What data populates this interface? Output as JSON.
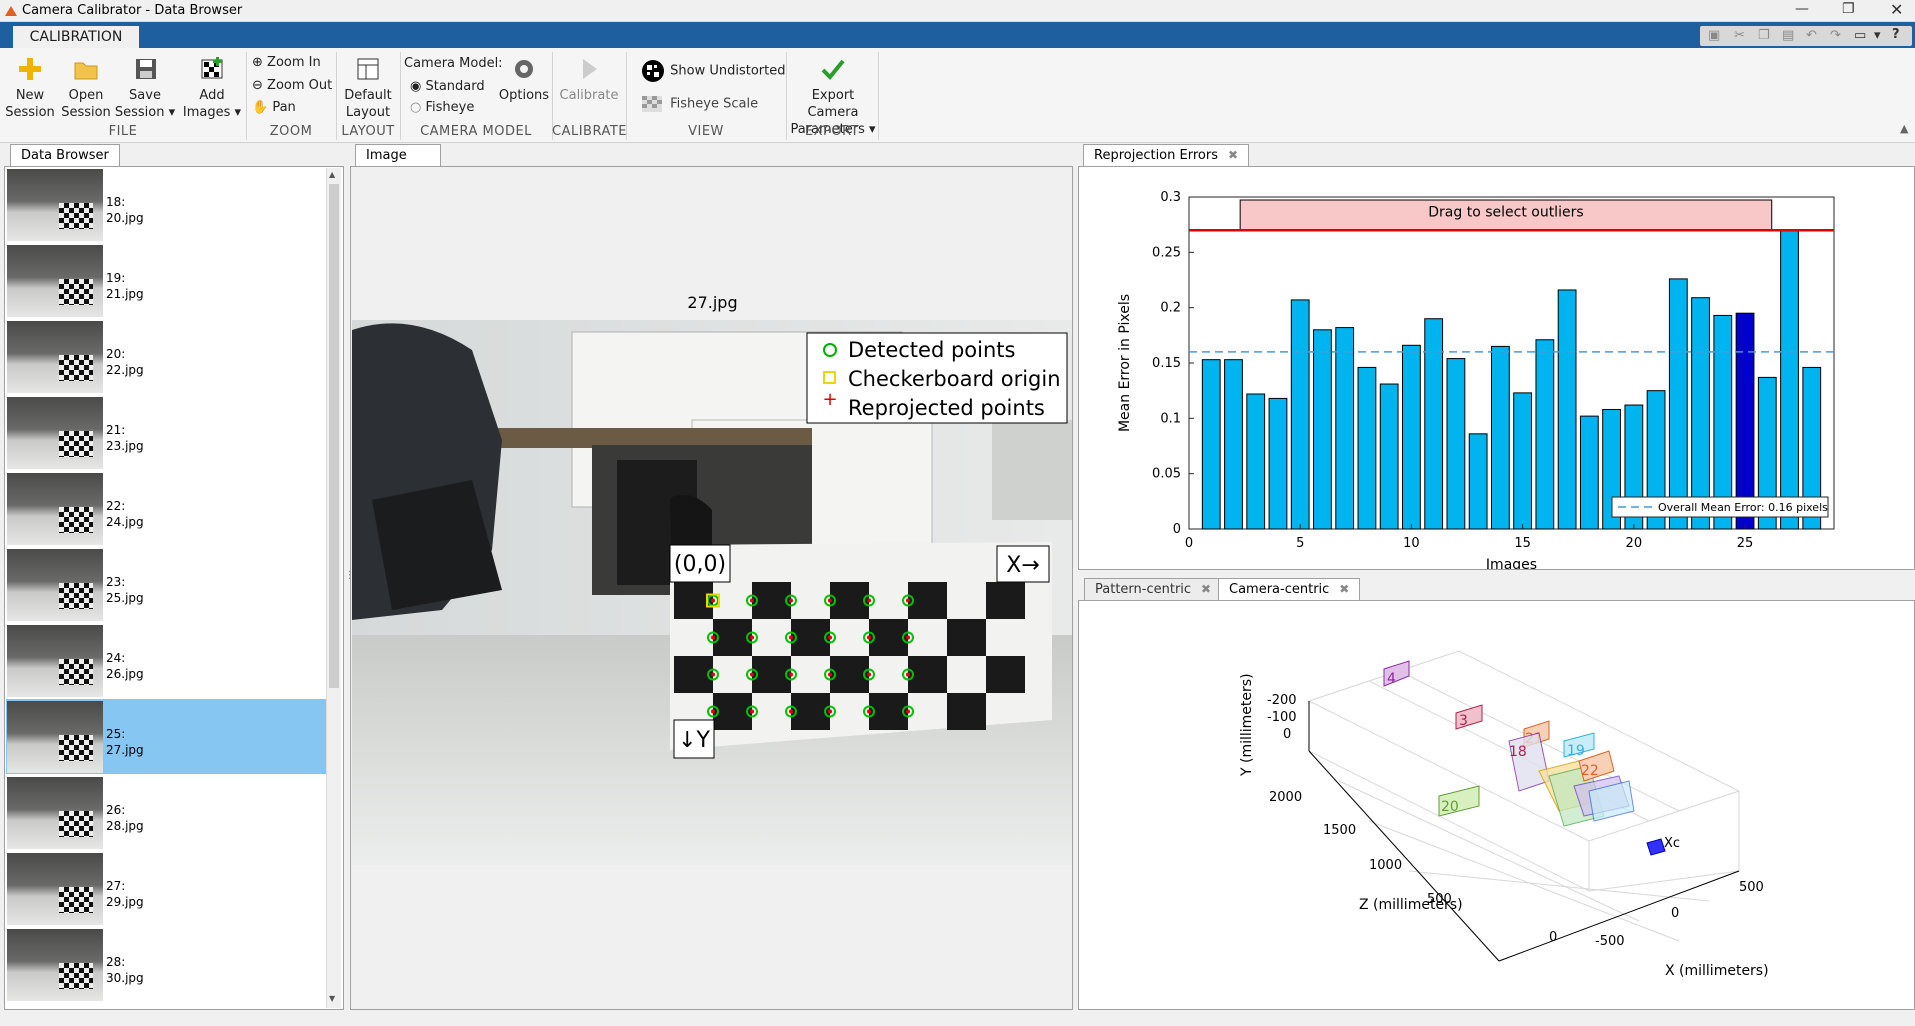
{
  "window": {
    "title": "Camera Calibrator - Data Browser"
  },
  "ribbon": {
    "tab": "CALIBRATION",
    "file": {
      "group": "FILE",
      "new_session": [
        "New",
        "Session"
      ],
      "open_session": [
        "Open",
        "Session"
      ],
      "save_session": [
        "Save",
        "Session ▾"
      ],
      "add_images": [
        "Add",
        "Images ▾"
      ]
    },
    "zoom": {
      "group": "ZOOM",
      "zoom_in": "Zoom In",
      "zoom_out": "Zoom Out",
      "pan": "Pan"
    },
    "layout": {
      "group": "LAYOUT",
      "default_layout": [
        "Default",
        "Layout"
      ]
    },
    "camera_model": {
      "group": "CAMERA MODEL",
      "label": "Camera Model:",
      "standard": "Standard",
      "fisheye": "Fisheye",
      "options": "Options",
      "selected": "Standard"
    },
    "calibrate": {
      "group": "CALIBRATE",
      "button": "Calibrate"
    },
    "view": {
      "group": "VIEW",
      "show_undistorted": "Show Undistorted",
      "fisheye_scale": "Fisheye Scale"
    },
    "export": {
      "group": "EXPORT",
      "button": [
        "Export Camera",
        "Parameters ▾"
      ]
    }
  },
  "data_browser": {
    "tab": "Data Browser",
    "items": [
      {
        "index": "18:",
        "file": "20.jpg"
      },
      {
        "index": "19:",
        "file": "21.jpg"
      },
      {
        "index": "20:",
        "file": "22.jpg"
      },
      {
        "index": "21:",
        "file": "23.jpg"
      },
      {
        "index": "22:",
        "file": "24.jpg"
      },
      {
        "index": "23:",
        "file": "25.jpg"
      },
      {
        "index": "24:",
        "file": "26.jpg"
      },
      {
        "index": "25:",
        "file": "27.jpg"
      },
      {
        "index": "26:",
        "file": "28.jpg"
      },
      {
        "index": "27:",
        "file": "29.jpg"
      },
      {
        "index": "28:",
        "file": "30.jpg"
      }
    ],
    "selected_index": 7
  },
  "image_panel": {
    "tab": "Image",
    "title": "27.jpg",
    "legend": [
      "Detected points",
      "Checkerboard origin",
      "Reprojected points"
    ],
    "origin_label": "(0,0)",
    "x_label": "X→",
    "y_label": "↓Y"
  },
  "reprojection": {
    "tab": "Reprojection Errors",
    "outlier_label": "Drag to select outliers",
    "legend": "Overall Mean Error: 0.16 pixels",
    "colors": {
      "bar": "#00b4f0",
      "selected": "#0000cc",
      "threshold": "#e00000",
      "outlier_box": "#f8c8c8",
      "mean_line": "#4a9ad8"
    }
  },
  "camera_view": {
    "tabs": [
      "Pattern-centric",
      "Camera-centric"
    ],
    "active_tab": "Camera-centric",
    "ylabel": "Y (millimeters)",
    "zlabel": "Z (millimeters)",
    "xlabel": "X (millimeters)",
    "y_ticks": [
      "-200",
      "-100",
      "0"
    ],
    "z_ticks": [
      "2000",
      "1500",
      "1000",
      "500",
      "0"
    ],
    "x_ticks": [
      "500",
      "0",
      "-500"
    ],
    "pattern_labels": [
      "4",
      "3",
      "21",
      "19",
      "18",
      "22",
      "20"
    ],
    "camera_label": "Xc"
  },
  "chart_data": {
    "type": "bar",
    "title": "",
    "xlabel": "Images",
    "ylabel": "Mean Error in Pixels",
    "ylim": [
      0,
      0.3
    ],
    "xlim": [
      0,
      29
    ],
    "x_ticks": [
      0,
      5,
      10,
      15,
      20,
      25
    ],
    "y_ticks": [
      0,
      0.05,
      0.1,
      0.15,
      0.2,
      0.25,
      0.3
    ],
    "categories": [
      1,
      2,
      3,
      4,
      5,
      6,
      7,
      8,
      9,
      10,
      11,
      12,
      13,
      14,
      15,
      16,
      17,
      18,
      19,
      20,
      21,
      22,
      23,
      24,
      25,
      26,
      27,
      28
    ],
    "values": [
      0.153,
      0.153,
      0.122,
      0.118,
      0.207,
      0.18,
      0.182,
      0.146,
      0.131,
      0.166,
      0.19,
      0.154,
      0.086,
      0.165,
      0.123,
      0.171,
      0.216,
      0.102,
      0.108,
      0.112,
      0.125,
      0.226,
      0.209,
      0.193,
      0.195,
      0.137,
      0.27,
      0.146
    ],
    "selected_category": 25,
    "mean_error": 0.16,
    "outlier_threshold": 0.27,
    "legend_placement": "bottom-right",
    "grid": false
  }
}
